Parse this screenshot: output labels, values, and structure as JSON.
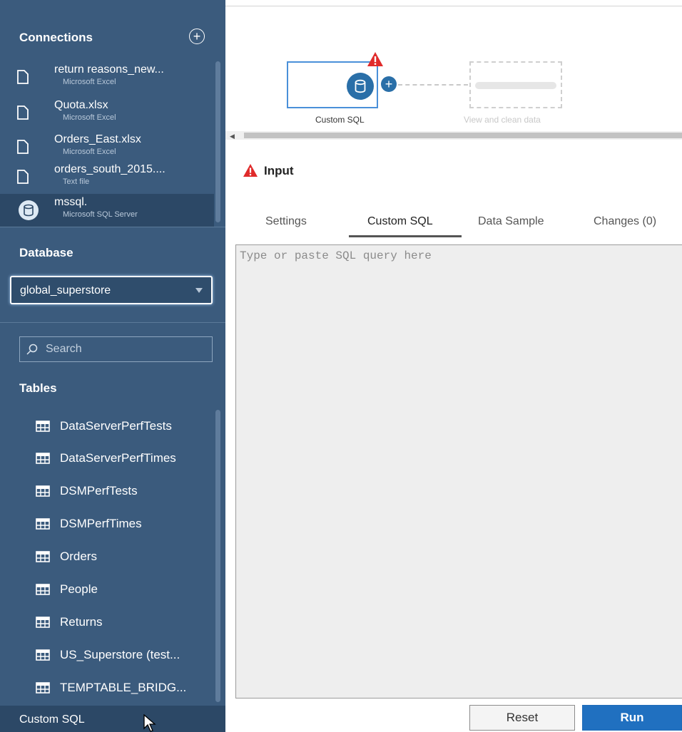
{
  "sidebar": {
    "connections_title": "Connections",
    "connections": [
      {
        "name": "return reasons_new...",
        "type": "Microsoft Excel",
        "icon": "file-icon"
      },
      {
        "name": "Quota.xlsx",
        "type": "Microsoft Excel",
        "icon": "file-icon"
      },
      {
        "name": "Orders_East.xlsx",
        "type": "Microsoft Excel",
        "icon": "file-icon"
      },
      {
        "name": "orders_south_2015....",
        "type": "Text file",
        "icon": "file-icon"
      },
      {
        "name": "mssql.",
        "type": "Microsoft SQL Server",
        "icon": "database-icon",
        "selected": true
      }
    ],
    "database_title": "Database",
    "database_value": "global_superstore",
    "search_placeholder": "Search",
    "tables_title": "Tables",
    "tables": [
      "DataServerPerfTests",
      "DataServerPerfTimes",
      "DSMPerfTests",
      "DSMPerfTimes",
      "Orders",
      "People",
      "Returns",
      "US_Superstore (test...",
      "TEMPTABLE_BRIDG..."
    ],
    "custom_sql_label": "Custom SQL"
  },
  "flow": {
    "node_label": "Custom SQL",
    "ghost_label": "View and clean data"
  },
  "panel": {
    "title": "Input",
    "tabs": [
      "Settings",
      "Custom SQL",
      "Data Sample",
      "Changes (0)"
    ],
    "active_tab": "Custom SQL",
    "editor_placeholder": "Type or paste SQL query here",
    "reset_label": "Reset",
    "run_label": "Run"
  },
  "colors": {
    "sidebar_bg": "#3b5b7d",
    "accent_blue": "#2070c0",
    "warning_red": "#e02b2b"
  }
}
